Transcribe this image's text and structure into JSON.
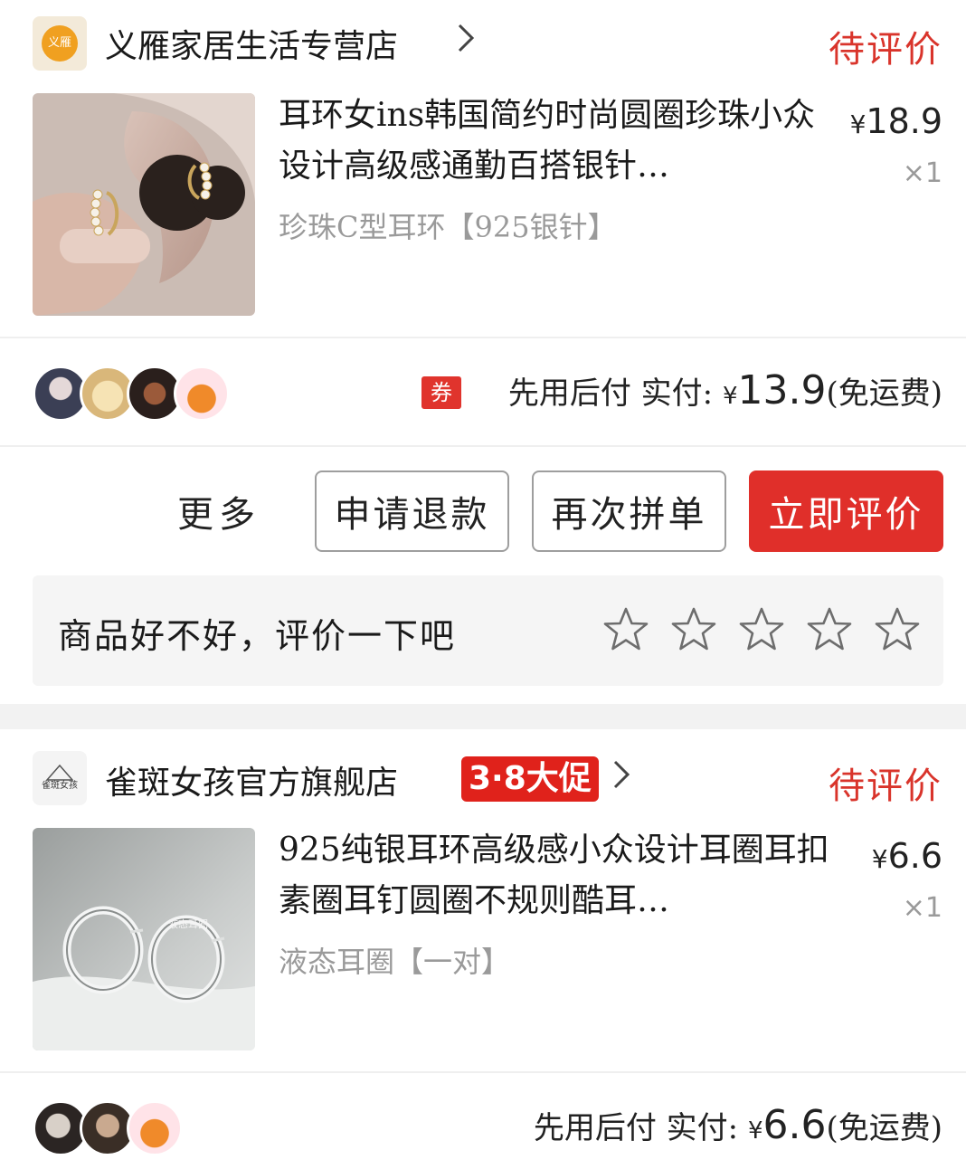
{
  "orders": [
    {
      "shop": {
        "logo_text": "义雁",
        "name": "义雁家居生活专营店",
        "chevron": "›",
        "promo_badge": ""
      },
      "status": "待评价",
      "item": {
        "title": "耳环女ins韩国简约时尚圆圈珍珠小众设计高级感通勤百搭银针…",
        "sku": "珍珠C型耳环【925银针】",
        "price_symbol": "¥",
        "price": "18.9",
        "qty": "×1"
      },
      "coupon_icon": "券",
      "payment": {
        "prefix": "先用后付 实付:",
        "symbol": "¥",
        "amount": "13.9",
        "suffix": "(免运费)"
      },
      "actions": {
        "more": "更多",
        "refund": "申请退款",
        "reorder": "再次拼单",
        "review": "立即评价"
      },
      "rating": {
        "prompt": "商品好不好，评价一下吧",
        "stars": 5,
        "value": 0
      }
    },
    {
      "shop": {
        "logo_text": "雀斑女孩",
        "name": "雀斑女孩官方旗舰店",
        "chevron": "›",
        "promo_badge": "3·8大促"
      },
      "status": "待评价",
      "item": {
        "title": "925纯银耳环高级感小众设计耳圈耳扣素圈耳钉圆圈不规则酷耳…",
        "sku": "液态耳圈【一对】",
        "price_symbol": "¥",
        "price": "6.6",
        "qty": "×1",
        "image_caption": "液态耳圈"
      },
      "payment": {
        "prefix": "先用后付 实付:",
        "symbol": "¥",
        "amount": "6.6",
        "suffix": "(免运费)"
      }
    }
  ],
  "icons": {
    "chevron": "chevron-right-icon",
    "star": "star-outline-icon",
    "coupon": "coupon-icon"
  },
  "colors": {
    "accent": "#e02f2a",
    "status": "#d9342b",
    "muted": "#9a9a9a",
    "rate_bg": "#f5f5f5"
  }
}
